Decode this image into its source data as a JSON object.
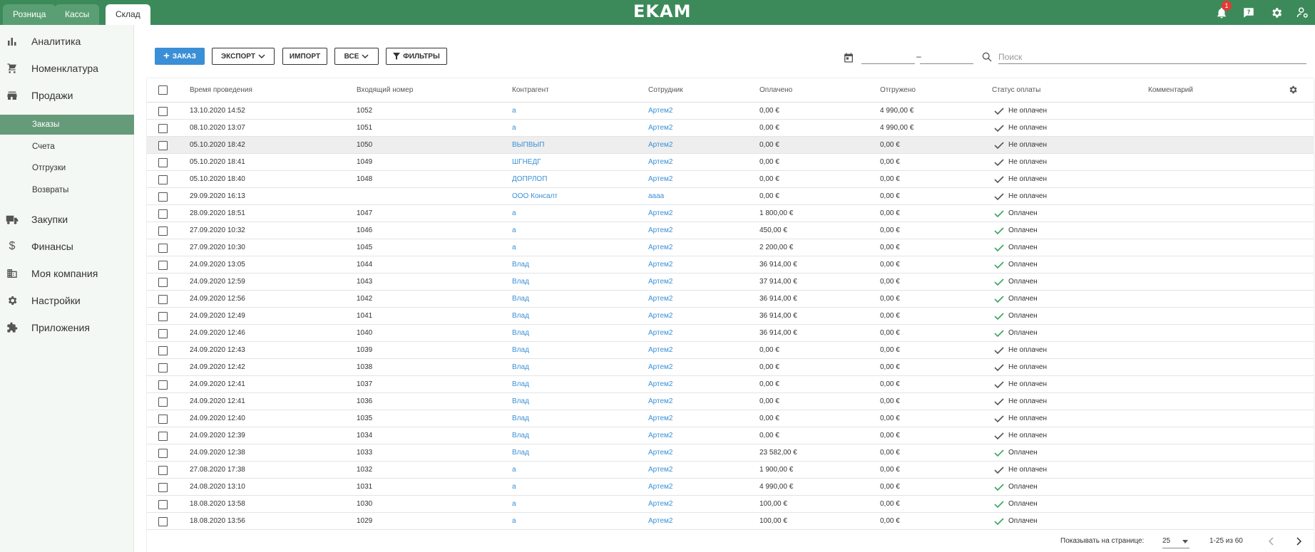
{
  "tabs": [
    {
      "label": "Розница",
      "active": false
    },
    {
      "label": "Кассы",
      "active": false
    },
    {
      "label": "Склад",
      "active": true
    }
  ],
  "logo": "EKAM",
  "notifications_count": "1",
  "sidebar": {
    "items": [
      {
        "label": "Аналитика",
        "icon": "bar-chart-icon"
      },
      {
        "label": "Номенклатура",
        "icon": "cart-icon"
      },
      {
        "label": "Продажи",
        "icon": "store-icon"
      },
      {
        "label": "Закупки",
        "icon": "truck-icon"
      },
      {
        "label": "Финансы",
        "icon": "dollar-icon"
      },
      {
        "label": "Моя компания",
        "icon": "building-icon"
      },
      {
        "label": "Настройки",
        "icon": "gear-icon"
      },
      {
        "label": "Приложения",
        "icon": "puzzle-icon"
      }
    ],
    "subitems": [
      {
        "label": "Заказы",
        "active": true
      },
      {
        "label": "Счета",
        "active": false
      },
      {
        "label": "Отгрузки",
        "active": false
      },
      {
        "label": "Возвраты",
        "active": false
      }
    ]
  },
  "toolbar": {
    "order_label": "ЗАКАЗ",
    "export_label": "ЭКСПОРТ",
    "import_label": "ИМПОРТ",
    "all_label": "ВСЕ",
    "filters_label": "ФИЛЬТРЫ",
    "date_separator": "–",
    "search_placeholder": "Поиск"
  },
  "table": {
    "headers": [
      "Время проведения",
      "Входящий номер",
      "Контрагент",
      "Сотрудник",
      "Оплачено",
      "Отгружено",
      "Статус оплаты",
      "Комментарий"
    ],
    "rows": [
      {
        "time": "13.10.2020 14:52",
        "num": "1052",
        "agent": "а",
        "emp": "Артем2",
        "paid": "0,00 €",
        "shipped": "4 990,00 €",
        "status": "Не оплачен",
        "ok": false
      },
      {
        "time": "08.10.2020 13:07",
        "num": "1051",
        "agent": "а",
        "emp": "Артем2",
        "paid": "0,00 €",
        "shipped": "4 990,00 €",
        "status": "Не оплачен",
        "ok": false
      },
      {
        "time": "05.10.2020 18:42",
        "num": "1050",
        "agent": "ВЫПВЫП",
        "emp": "Артем2",
        "paid": "0,00 €",
        "shipped": "0,00 €",
        "status": "Не оплачен",
        "ok": false
      },
      {
        "time": "05.10.2020 18:41",
        "num": "1049",
        "agent": "ШГНЕДГ",
        "emp": "Артем2",
        "paid": "0,00 €",
        "shipped": "0,00 €",
        "status": "Не оплачен",
        "ok": false
      },
      {
        "time": "05.10.2020 18:40",
        "num": "1048",
        "agent": "ДОПРЛОП",
        "emp": "Артем2",
        "paid": "0,00 €",
        "shipped": "0,00 €",
        "status": "Не оплачен",
        "ok": false
      },
      {
        "time": "29.09.2020 16:13",
        "num": "",
        "agent": "ООО Консалт",
        "emp": "аааа",
        "paid": "0,00 €",
        "shipped": "0,00 €",
        "status": "Не оплачен",
        "ok": false
      },
      {
        "time": "28.09.2020 18:51",
        "num": "1047",
        "agent": "а",
        "emp": "Артем2",
        "paid": "1 800,00 €",
        "shipped": "0,00 €",
        "status": "Оплачен",
        "ok": true
      },
      {
        "time": "27.09.2020 10:32",
        "num": "1046",
        "agent": "а",
        "emp": "Артем2",
        "paid": "450,00 €",
        "shipped": "0,00 €",
        "status": "Оплачен",
        "ok": true
      },
      {
        "time": "27.09.2020 10:30",
        "num": "1045",
        "agent": "а",
        "emp": "Артем2",
        "paid": "2 200,00 €",
        "shipped": "0,00 €",
        "status": "Оплачен",
        "ok": true
      },
      {
        "time": "24.09.2020 13:05",
        "num": "1044",
        "agent": "Влад",
        "emp": "Артем2",
        "paid": "36 914,00 €",
        "shipped": "0,00 €",
        "status": "Оплачен",
        "ok": true
      },
      {
        "time": "24.09.2020 12:59",
        "num": "1043",
        "agent": "Влад",
        "emp": "Артем2",
        "paid": "37 914,00 €",
        "shipped": "0,00 €",
        "status": "Оплачен",
        "ok": true
      },
      {
        "time": "24.09.2020 12:56",
        "num": "1042",
        "agent": "Влад",
        "emp": "Артем2",
        "paid": "36 914,00 €",
        "shipped": "0,00 €",
        "status": "Оплачен",
        "ok": true
      },
      {
        "time": "24.09.2020 12:49",
        "num": "1041",
        "agent": "Влад",
        "emp": "Артем2",
        "paid": "36 914,00 €",
        "shipped": "0,00 €",
        "status": "Оплачен",
        "ok": true
      },
      {
        "time": "24.09.2020 12:46",
        "num": "1040",
        "agent": "Влад",
        "emp": "Артем2",
        "paid": "36 914,00 €",
        "shipped": "0,00 €",
        "status": "Оплачен",
        "ok": true
      },
      {
        "time": "24.09.2020 12:43",
        "num": "1039",
        "agent": "Влад",
        "emp": "Артем2",
        "paid": "0,00 €",
        "shipped": "0,00 €",
        "status": "Не оплачен",
        "ok": false
      },
      {
        "time": "24.09.2020 12:42",
        "num": "1038",
        "agent": "Влад",
        "emp": "Артем2",
        "paid": "0,00 €",
        "shipped": "0,00 €",
        "status": "Не оплачен",
        "ok": false
      },
      {
        "time": "24.09.2020 12:41",
        "num": "1037",
        "agent": "Влад",
        "emp": "Артем2",
        "paid": "0,00 €",
        "shipped": "0,00 €",
        "status": "Не оплачен",
        "ok": false
      },
      {
        "time": "24.09.2020 12:41",
        "num": "1036",
        "agent": "Влад",
        "emp": "Артем2",
        "paid": "0,00 €",
        "shipped": "0,00 €",
        "status": "Не оплачен",
        "ok": false
      },
      {
        "time": "24.09.2020 12:40",
        "num": "1035",
        "agent": "Влад",
        "emp": "Артем2",
        "paid": "0,00 €",
        "shipped": "0,00 €",
        "status": "Не оплачен",
        "ok": false
      },
      {
        "time": "24.09.2020 12:39",
        "num": "1034",
        "agent": "Влад",
        "emp": "Артем2",
        "paid": "0,00 €",
        "shipped": "0,00 €",
        "status": "Не оплачен",
        "ok": false
      },
      {
        "time": "24.09.2020 12:38",
        "num": "1033",
        "agent": "Влад",
        "emp": "Артем2",
        "paid": "23 582,00 €",
        "shipped": "0,00 €",
        "status": "Оплачен",
        "ok": true
      },
      {
        "time": "27.08.2020 17:38",
        "num": "1032",
        "agent": "а",
        "emp": "Артем2",
        "paid": "1 900,00 €",
        "shipped": "0,00 €",
        "status": "Не оплачен",
        "ok": false
      },
      {
        "time": "24.08.2020 13:10",
        "num": "1031",
        "agent": "а",
        "emp": "Артем2",
        "paid": "4 990,00 €",
        "shipped": "0,00 €",
        "status": "Оплачен",
        "ok": true
      },
      {
        "time": "18.08.2020 13:58",
        "num": "1030",
        "agent": "а",
        "emp": "Артем2",
        "paid": "100,00 €",
        "shipped": "0,00 €",
        "status": "Оплачен",
        "ok": true
      },
      {
        "time": "18.08.2020 13:56",
        "num": "1029",
        "agent": "а",
        "emp": "Артем2",
        "paid": "100,00 €",
        "shipped": "0,00 €",
        "status": "Оплачен",
        "ok": true
      }
    ]
  },
  "footer": {
    "per_page_label": "Показывать на странице:",
    "per_page_value": "25",
    "range": "1-25 из 60"
  },
  "colors": {
    "topbar": "#3c8a5a",
    "active_sub": "#669b79",
    "primary": "#3a8fd6",
    "paid_check": "#3aa35a"
  }
}
